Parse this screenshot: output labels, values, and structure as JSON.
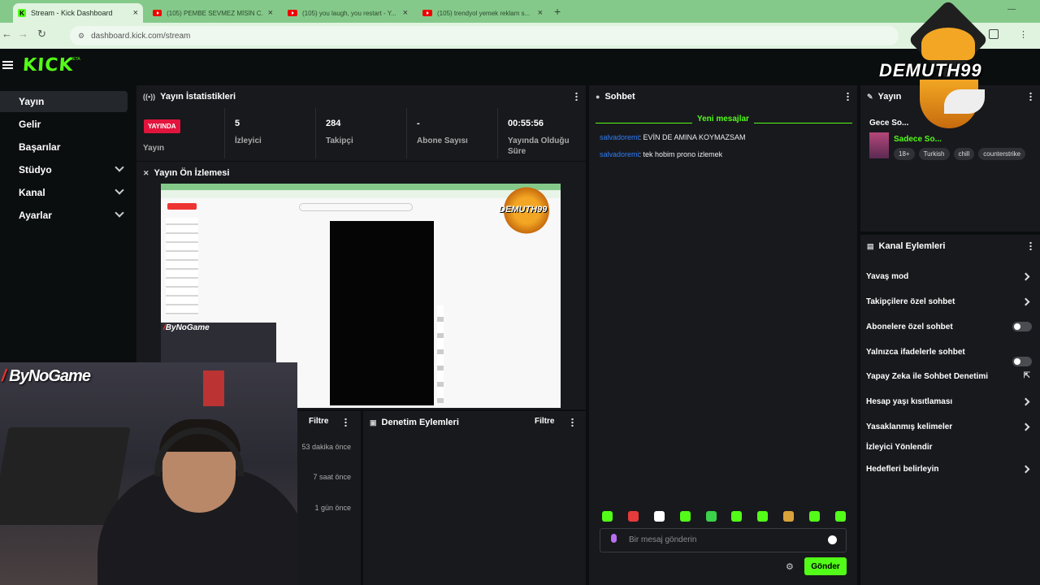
{
  "browser": {
    "tabs": [
      {
        "title": "Stream - Kick Dashboard",
        "icon": "kick-icon"
      },
      {
        "title": "(105) PEMBE SEVMEZ MİSİN C...",
        "icon": "youtube-icon"
      },
      {
        "title": "(105) you laugh, you restart - Y...",
        "icon": "youtube-icon"
      },
      {
        "title": "(105) trendyol yemek reklam s...",
        "icon": "youtube-icon"
      }
    ],
    "url": "dashboard.kick.com/stream"
  },
  "header": {
    "logo": "KICK",
    "beta": "BETA"
  },
  "sidebar": {
    "items": [
      {
        "label": "Yayın",
        "active": true
      },
      {
        "label": "Gelir"
      },
      {
        "label": "Başarılar"
      },
      {
        "label": "Stüdyo",
        "expandable": true
      },
      {
        "label": "Kanal",
        "expandable": true
      },
      {
        "label": "Ayarlar",
        "expandable": true
      }
    ]
  },
  "stats": {
    "title": "Yayın İstatistikleri",
    "live_badge": "YAYINDA",
    "stream_label": "Yayın",
    "viewers": "5",
    "viewers_label": "İzleyici",
    "followers": "284",
    "followers_label": "Takipçi",
    "subs": "-",
    "subs_label": "Abone Sayısı",
    "uptime": "00:55:56",
    "uptime_label1": "Yayında Olduğu",
    "uptime_label2": "Süre"
  },
  "preview": {
    "title": "Yayın Ön İzlemesi"
  },
  "overlay": {
    "streamer_name": "ByNoGame",
    "small_name": "ByNoGame",
    "logo_text": "DEMUTH99"
  },
  "activity": {
    "filter_label": "Filtre",
    "times": [
      "53 dakika önce",
      "7 saat önce",
      "1 gün önce"
    ]
  },
  "moderation": {
    "title": "Denetim Eylemleri",
    "filter_label": "Filtre"
  },
  "chat": {
    "title": "Sohbet",
    "new_messages": "Yeni mesajlar",
    "messages": [
      {
        "user": "salvadoremi",
        "text": ": EVİN DE AMINA KOYMAZSAM"
      },
      {
        "user": "salvadoremi",
        "text": ": tek hobim prono izlemek"
      }
    ],
    "placeholder": "Bir mesaj gönderin",
    "send_label": "Gönder",
    "emote_colors": [
      "#53fc18",
      "#e63b3b",
      "#ffffff",
      "#53fc18",
      "#3bd14a",
      "#53fc18",
      "#53fc18",
      "#d9a23b",
      "#53fc18",
      "#53fc18"
    ]
  },
  "stream_info": {
    "title": "Yayın",
    "stream_title": "Gece So...",
    "category": "Sadece So...",
    "tags": [
      "18+",
      "Turkish",
      "chill",
      "counterstrike"
    ]
  },
  "channel_actions": {
    "title": "Kanal Eylemleri",
    "items": [
      {
        "label": "Yavaş mod",
        "control": "arrow"
      },
      {
        "label": "Takipçilere özel sohbet",
        "control": "arrow"
      },
      {
        "label": "Abonelere özel sohbet",
        "control": "toggle"
      },
      {
        "label": "Yalnızca ifadelerle sohbet",
        "control": "toggle"
      },
      {
        "label": "Yapay Zeka ile Sohbet Denetimi",
        "control": "external"
      },
      {
        "label": "Hesap yaşı kısıtlaması",
        "control": "arrow"
      },
      {
        "label": "Yasaklanmış kelimeler",
        "control": "arrow"
      },
      {
        "label": "İzleyici Yönlendir",
        "control": "none"
      },
      {
        "label": "Hedefleri belirleyin",
        "control": "arrow"
      }
    ]
  },
  "colors": {
    "brand": "#53fc18",
    "live": "#e2143d",
    "username": "#2f7df6"
  }
}
